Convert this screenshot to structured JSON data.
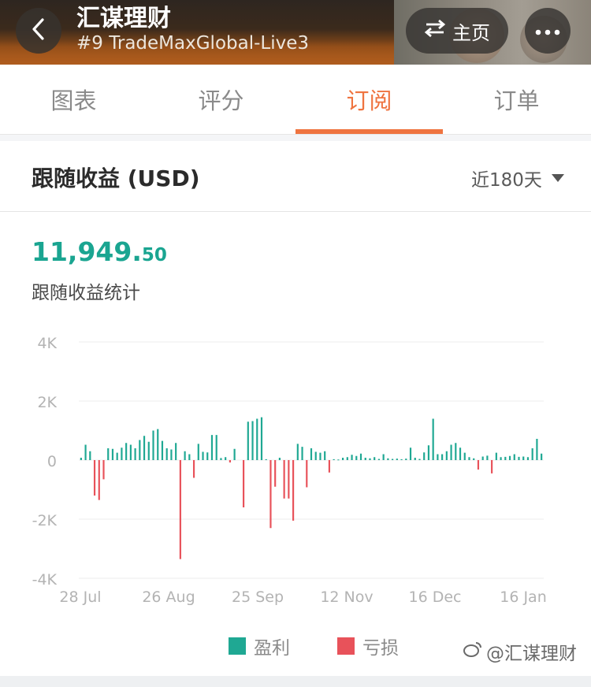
{
  "header": {
    "title": "汇谋理财",
    "subtitle": "#9 TradeMaxGlobal-Live3",
    "home_label": "主页"
  },
  "tabs": [
    {
      "label": "图表",
      "active": false
    },
    {
      "label": "评分",
      "active": false
    },
    {
      "label": "订阅",
      "active": true
    },
    {
      "label": "订单",
      "active": false
    }
  ],
  "section": {
    "title": "跟随收益 (USD)",
    "period": "近180天"
  },
  "summary": {
    "amount_int": "11,949.",
    "amount_dec": "50",
    "label": "跟随收益统计"
  },
  "legend": {
    "profit": "盈利",
    "loss": "亏损"
  },
  "colors": {
    "profit": "#1fa893",
    "loss": "#e8525a",
    "accent": "#ef7440"
  },
  "watermark": "@汇谋理财",
  "chart_data": {
    "type": "bar",
    "ylim": [
      -4000,
      4000
    ],
    "yticks": [
      {
        "v": 4000,
        "label": "4K"
      },
      {
        "v": 2000,
        "label": "2K"
      },
      {
        "v": 0,
        "label": "0"
      },
      {
        "v": -2000,
        "label": "-2K"
      },
      {
        "v": -4000,
        "label": "-4K"
      }
    ],
    "xticks": [
      "28 Jul",
      "26 Aug",
      "25 Sep",
      "12 Nov",
      "16 Dec",
      "16 Jan"
    ],
    "values": [
      80,
      520,
      300,
      -1200,
      -1350,
      -650,
      400,
      380,
      250,
      420,
      580,
      520,
      400,
      680,
      820,
      620,
      1000,
      1050,
      650,
      400,
      360,
      580,
      -3350,
      300,
      200,
      -600,
      550,
      280,
      260,
      850,
      850,
      70,
      100,
      -80,
      380,
      0,
      -1600,
      1300,
      1320,
      1400,
      1450,
      30,
      -2300,
      -900,
      80,
      -1300,
      -1300,
      -2050,
      550,
      450,
      -920,
      400,
      280,
      250,
      300,
      -420,
      30,
      20,
      80,
      100,
      180,
      140,
      220,
      80,
      60,
      100,
      40,
      200,
      60,
      40,
      50,
      30,
      50,
      420,
      80,
      40,
      260,
      500,
      1400,
      200,
      200,
      300,
      520,
      580,
      420,
      250,
      100,
      60,
      -320,
      120,
      150,
      -450,
      250,
      100,
      110,
      140,
      200,
      110,
      120,
      100,
      400,
      720,
      220
    ]
  }
}
